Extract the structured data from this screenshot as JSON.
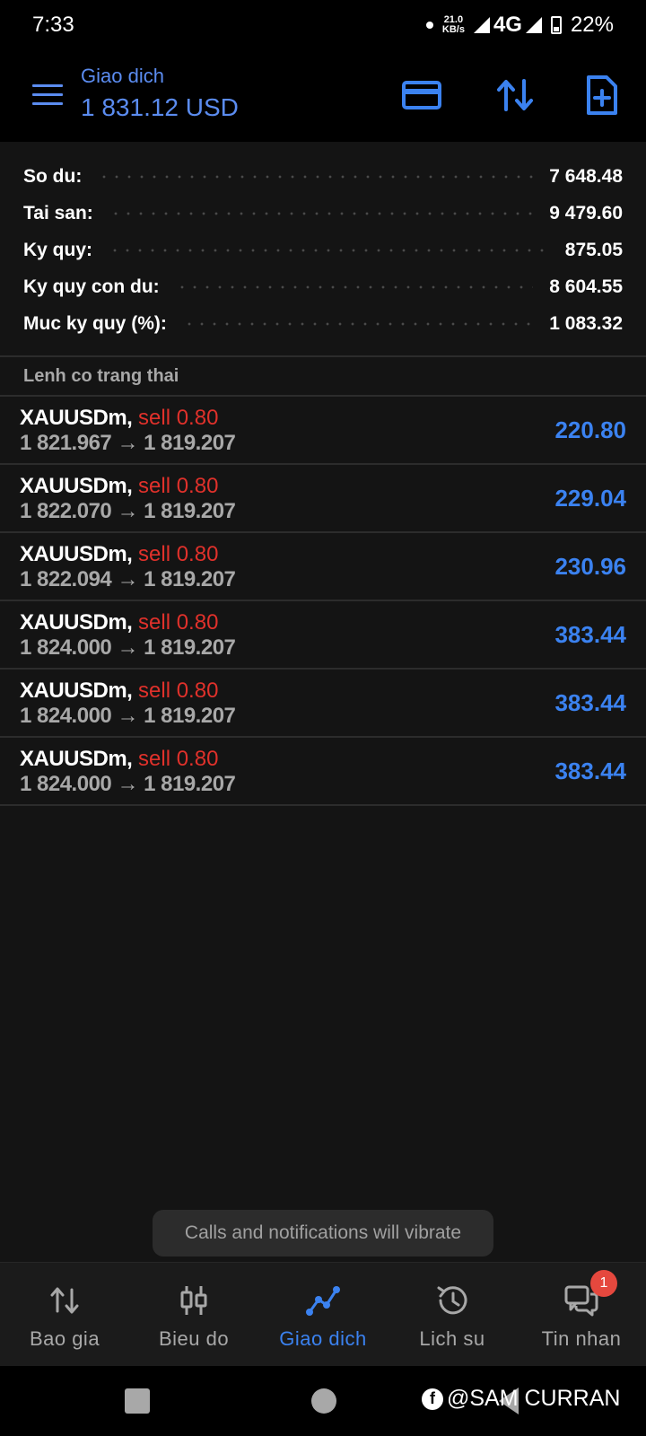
{
  "status_bar": {
    "time": "7:33",
    "speed_value": "21.0",
    "speed_unit": "KB/s",
    "network": "4G",
    "battery": "22%"
  },
  "header": {
    "title": "Giao dich",
    "balance": "1 831.12 USD",
    "accent_color": "#5b8cf0"
  },
  "summary": [
    {
      "label": "So du:",
      "value": "7 648.48"
    },
    {
      "label": "Tai san:",
      "value": "9 479.60"
    },
    {
      "label": "Ky quy:",
      "value": "875.05"
    },
    {
      "label": "Ky quy con du:",
      "value": "8 604.55"
    },
    {
      "label": "Muc ky quy (%):",
      "value": "1 083.32"
    }
  ],
  "section": {
    "title": "Lenh co trang thai"
  },
  "positions": [
    {
      "symbol": "XAUUSDm,",
      "type": "sell 0.80",
      "open": "1 821.967",
      "arrow": "→",
      "current": "1 819.207",
      "profit": "220.80"
    },
    {
      "symbol": "XAUUSDm,",
      "type": "sell 0.80",
      "open": "1 822.070",
      "arrow": "→",
      "current": "1 819.207",
      "profit": "229.04"
    },
    {
      "symbol": "XAUUSDm,",
      "type": "sell 0.80",
      "open": "1 822.094",
      "arrow": "→",
      "current": "1 819.207",
      "profit": "230.96"
    },
    {
      "symbol": "XAUUSDm,",
      "type": "sell 0.80",
      "open": "1 824.000",
      "arrow": "→",
      "current": "1 819.207",
      "profit": "383.44"
    },
    {
      "symbol": "XAUUSDm,",
      "type": "sell 0.80",
      "open": "1 824.000",
      "arrow": "→",
      "current": "1 819.207",
      "profit": "383.44"
    },
    {
      "symbol": "XAUUSDm,",
      "type": "sell 0.80",
      "open": "1 824.000",
      "arrow": "→",
      "current": "1 819.207",
      "profit": "383.44"
    }
  ],
  "toast": {
    "text": "Calls and notifications will vibrate"
  },
  "bottom_nav": {
    "items": [
      {
        "label": "Bao gia",
        "icon": "quotes-arrows-icon"
      },
      {
        "label": "Bieu do",
        "icon": "candlestick-chart-icon"
      },
      {
        "label": "Giao dich",
        "icon": "trade-line-icon",
        "active": true
      },
      {
        "label": "Lich su",
        "icon": "history-clock-icon"
      },
      {
        "label": "Tin nhan",
        "icon": "messages-icon",
        "badge": "1"
      }
    ],
    "active_color": "#3b82f0"
  },
  "watermark": {
    "text": "@SAM CURRAN"
  }
}
